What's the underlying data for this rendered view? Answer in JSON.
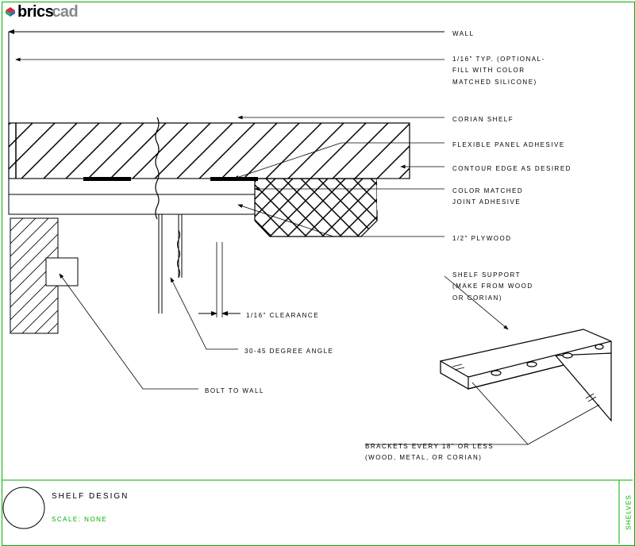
{
  "logo": {
    "text1": "brics",
    "text2": "cad"
  },
  "title": "SHELF DESIGN",
  "scale": "SCALE: NONE",
  "side_label": "SHELVES",
  "labels": {
    "wall": "WALL",
    "gap": "1/16\" TYP. (OPTIONAL-\nFILL WITH COLOR\nMATCHED SILICONE)",
    "corian": "CORIAN SHELF",
    "adhesive": "FLEXIBLE PANEL ADHESIVE",
    "contour": "CONTOUR EDGE AS DESIRED",
    "joint": "COLOR MATCHED\nJOINT ADHESIVE",
    "plywood": "1/2\" PLYWOOD",
    "support": "SHELF SUPPORT\n(MAKE FROM WOOD\nOR CORIAN)",
    "clearance": "1/16\" CLEARANCE",
    "angle": "30-45 DEGREE ANGLE",
    "bolt": "BOLT TO WALL",
    "brackets": "BRACKETS EVERY 18\" OR LESS\n(WOOD, METAL, OR CORIAN)"
  }
}
